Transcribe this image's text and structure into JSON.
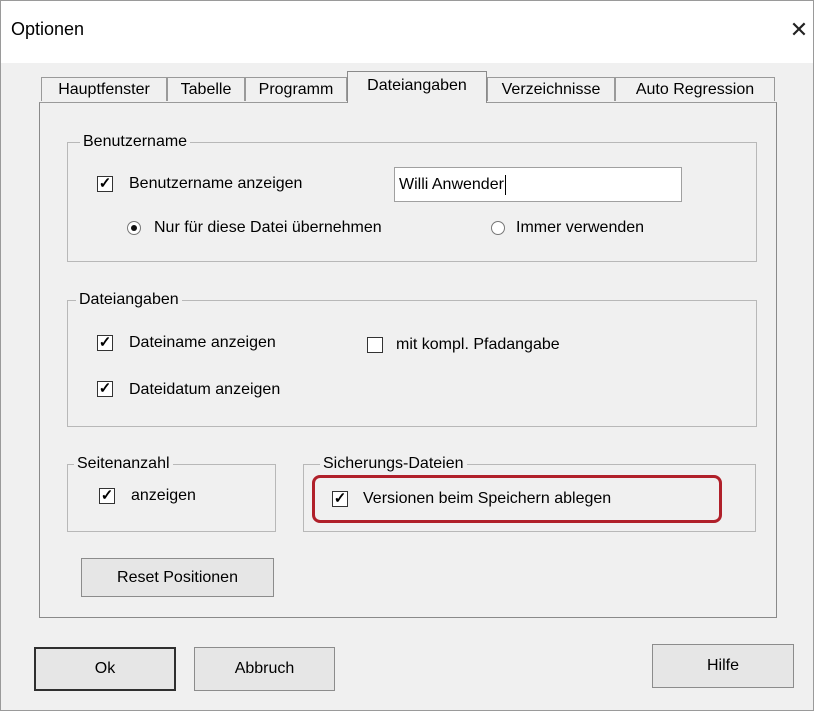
{
  "window": {
    "title": "Optionen",
    "close_symbol": "✕"
  },
  "tabs": [
    {
      "label": "Hauptfenster",
      "active": false
    },
    {
      "label": "Tabelle",
      "active": false
    },
    {
      "label": "Programm",
      "active": false
    },
    {
      "label": "Dateiangaben",
      "active": true
    },
    {
      "label": "Verzeichnisse",
      "active": false
    },
    {
      "label": "Auto Regression",
      "active": false
    }
  ],
  "benutzername": {
    "legend": "Benutzername",
    "show_label": "Benutzername anzeigen",
    "show_checked": true,
    "name_value": "Willi Anwender",
    "radio_file_label": "Nur für diese Datei übernehmen",
    "radio_always_label": "Immer verwenden",
    "selected_radio": "file"
  },
  "dateiangaben": {
    "legend": "Dateiangaben",
    "name_label": "Dateiname anzeigen",
    "name_checked": true,
    "path_label": "mit kompl. Pfadangabe",
    "path_checked": false,
    "date_label": "Dateidatum anzeigen",
    "date_checked": true
  },
  "seitenanzahl": {
    "legend": "Seitenanzahl",
    "label": "anzeigen",
    "checked": true
  },
  "sicherung": {
    "legend": "Sicherungs-Dateien",
    "label": "Versionen beim Speichern ablegen",
    "checked": true
  },
  "buttons": {
    "reset": "Reset Positionen",
    "ok": "Ok",
    "cancel": "Abbruch",
    "help": "Hilfe"
  },
  "check_mark": "✓",
  "colors": {
    "highlight": "#b0202a",
    "background": "#f0f0f0"
  }
}
